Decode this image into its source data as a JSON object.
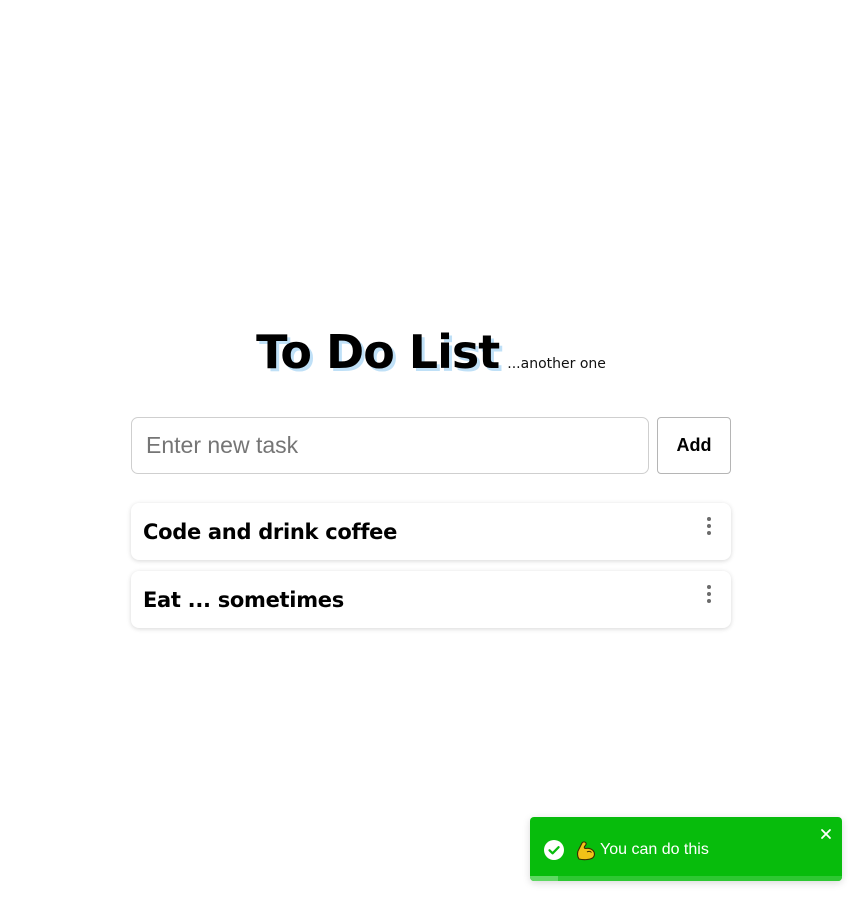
{
  "header": {
    "title": "To Do List",
    "subtitle": "...another one"
  },
  "form": {
    "input_value": "",
    "input_placeholder": "Enter new task",
    "add_label": "Add"
  },
  "tasks": [
    {
      "text": "Code and drink coffee"
    },
    {
      "text": "Eat ... sometimes"
    }
  ],
  "toast": {
    "message": "You can do this",
    "status": "success",
    "status_icon": "check-circle-icon",
    "emoji_icon": "flexed-biceps-icon",
    "close_icon": "close-icon",
    "progress_remaining": 0.91,
    "color": "#07bc0c"
  },
  "colors": {
    "accent_shadow": "#bfe0f7",
    "toast_bg": "#07bc0c"
  }
}
